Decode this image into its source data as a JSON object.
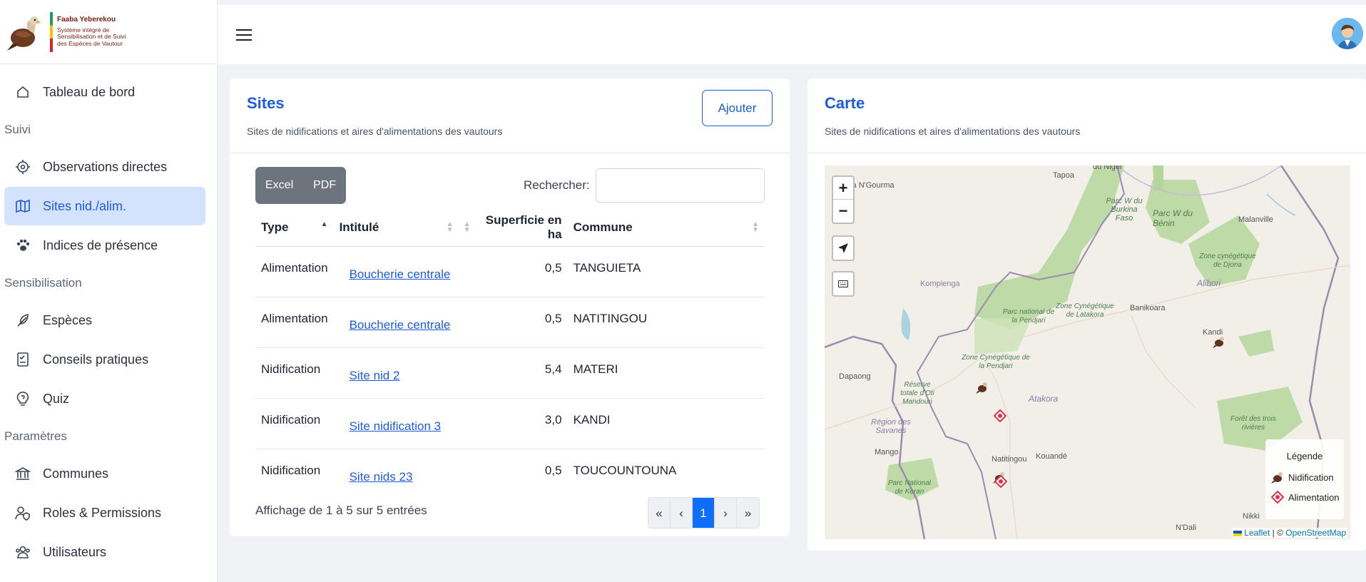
{
  "brand": {
    "name": "Faaba Yeberekou",
    "subtitle": "Système intégré de Sensibilisation et de Suivi des Espèces de Vautour"
  },
  "sidebar": {
    "items": [
      {
        "label": "Tableau de bord",
        "icon": "home-icon"
      },
      {
        "section": "Suivi"
      },
      {
        "label": "Observations directes",
        "icon": "target-icon"
      },
      {
        "label": "Sites nid./alim.",
        "icon": "map-icon",
        "active": true
      },
      {
        "label": "Indices de présence",
        "icon": "paw-icon"
      },
      {
        "section": "Sensibilisation"
      },
      {
        "label": "Espèces",
        "icon": "feather-icon"
      },
      {
        "label": "Conseils pratiques",
        "icon": "checklist-icon"
      },
      {
        "label": "Quiz",
        "icon": "help-bulb-icon"
      },
      {
        "section": "Paramètres"
      },
      {
        "label": "Communes",
        "icon": "building-icon"
      },
      {
        "label": "Roles & Permissions",
        "icon": "user-shield-icon"
      },
      {
        "label": "Utilisateurs",
        "icon": "users-icon"
      }
    ]
  },
  "sites": {
    "title": "Sites",
    "subtitle": "Sites de nidifications et aires d'alimentations des vautours",
    "add_label": "Ajouter",
    "export_buttons": [
      "Excel",
      "PDF"
    ],
    "search_label": "Rechercher:",
    "search_value": "",
    "columns": [
      "Type",
      "Intitulé",
      "Superficie en ha",
      "Commune"
    ],
    "rows": [
      {
        "type": "Alimentation",
        "name": "Boucherie centrale",
        "area": "0,5",
        "commune": "TANGUIETA"
      },
      {
        "type": "Alimentation",
        "name": "Boucherie centrale",
        "area": "0,5",
        "commune": "NATITINGOU"
      },
      {
        "type": "Nidification",
        "name": "Site nid 2",
        "area": "5,4",
        "commune": "MATERI"
      },
      {
        "type": "Nidification",
        "name": "Site nidification 3",
        "area": "3,0",
        "commune": "KANDI"
      },
      {
        "type": "Nidification",
        "name": "Site nids 23",
        "area": "0,5",
        "commune": "TOUCOUNTOUNA"
      }
    ],
    "info": "Affichage de 1 à 5 sur 5 entrées",
    "pagination": [
      "«",
      "‹",
      "1",
      "›",
      "»"
    ],
    "current_page": "1"
  },
  "map": {
    "title": "Carte",
    "subtitle": "Sites de nidifications et aires d'alimentations des vautours",
    "zoom_in": "+",
    "zoom_out": "−",
    "legend_title": "Légende",
    "legend_items": [
      {
        "label": "Nidification",
        "icon": "vulture-icon"
      },
      {
        "label": "Alimentation",
        "icon": "diamond-marker-icon"
      }
    ],
    "attribution_leaflet": "Leaflet",
    "attribution_sep": " | © ",
    "attribution_osm": "OpenStreetMap",
    "places": [
      "Tapoa",
      "du Niger",
      "ida N'Gourma",
      "Parc W du Burkina Faso",
      "Parc W du Bénin",
      "Malanville",
      "Zone cynégétique de Djona",
      "Alibori",
      "Kompienga",
      "Parc national de la Pendjari",
      "Zone Cynégétique de Latakora",
      "Banikoara",
      "Kandi",
      "Zone Cynégétique de la Pendjari",
      "Dapaong",
      "Réserve totale d'Oti Mandouri",
      "Atakora",
      "Région des Savanes",
      "Forêt des trois rivières",
      "Mango",
      "Natitingou",
      "Kouandé",
      "Parc National de Keran",
      "Nikki",
      "N'Dali"
    ],
    "colors": {
      "park": "#a8d08d",
      "water": "#aad3df",
      "border": "#9a8bb0"
    }
  },
  "colors": {
    "accent": "#1d5ce0",
    "active_bg": "#d5e2fd",
    "export_btn": "#6c757d",
    "page_current": "#0d6efd"
  }
}
